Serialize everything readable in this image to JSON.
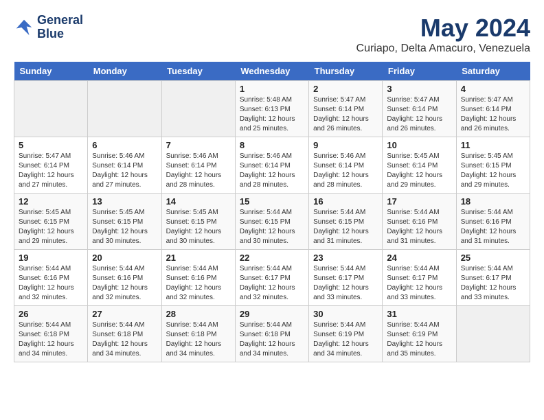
{
  "header": {
    "logo_line1": "General",
    "logo_line2": "Blue",
    "title": "May 2024",
    "subtitle": "Curiapo, Delta Amacuro, Venezuela"
  },
  "days_of_week": [
    "Sunday",
    "Monday",
    "Tuesday",
    "Wednesday",
    "Thursday",
    "Friday",
    "Saturday"
  ],
  "weeks": [
    [
      {
        "day": "",
        "info": ""
      },
      {
        "day": "",
        "info": ""
      },
      {
        "day": "",
        "info": ""
      },
      {
        "day": "1",
        "info": "Sunrise: 5:48 AM\nSunset: 6:13 PM\nDaylight: 12 hours and 25 minutes."
      },
      {
        "day": "2",
        "info": "Sunrise: 5:47 AM\nSunset: 6:14 PM\nDaylight: 12 hours and 26 minutes."
      },
      {
        "day": "3",
        "info": "Sunrise: 5:47 AM\nSunset: 6:14 PM\nDaylight: 12 hours and 26 minutes."
      },
      {
        "day": "4",
        "info": "Sunrise: 5:47 AM\nSunset: 6:14 PM\nDaylight: 12 hours and 26 minutes."
      }
    ],
    [
      {
        "day": "5",
        "info": "Sunrise: 5:47 AM\nSunset: 6:14 PM\nDaylight: 12 hours and 27 minutes."
      },
      {
        "day": "6",
        "info": "Sunrise: 5:46 AM\nSunset: 6:14 PM\nDaylight: 12 hours and 27 minutes."
      },
      {
        "day": "7",
        "info": "Sunrise: 5:46 AM\nSunset: 6:14 PM\nDaylight: 12 hours and 28 minutes."
      },
      {
        "day": "8",
        "info": "Sunrise: 5:46 AM\nSunset: 6:14 PM\nDaylight: 12 hours and 28 minutes."
      },
      {
        "day": "9",
        "info": "Sunrise: 5:46 AM\nSunset: 6:14 PM\nDaylight: 12 hours and 28 minutes."
      },
      {
        "day": "10",
        "info": "Sunrise: 5:45 AM\nSunset: 6:14 PM\nDaylight: 12 hours and 29 minutes."
      },
      {
        "day": "11",
        "info": "Sunrise: 5:45 AM\nSunset: 6:15 PM\nDaylight: 12 hours and 29 minutes."
      }
    ],
    [
      {
        "day": "12",
        "info": "Sunrise: 5:45 AM\nSunset: 6:15 PM\nDaylight: 12 hours and 29 minutes."
      },
      {
        "day": "13",
        "info": "Sunrise: 5:45 AM\nSunset: 6:15 PM\nDaylight: 12 hours and 30 minutes."
      },
      {
        "day": "14",
        "info": "Sunrise: 5:45 AM\nSunset: 6:15 PM\nDaylight: 12 hours and 30 minutes."
      },
      {
        "day": "15",
        "info": "Sunrise: 5:44 AM\nSunset: 6:15 PM\nDaylight: 12 hours and 30 minutes."
      },
      {
        "day": "16",
        "info": "Sunrise: 5:44 AM\nSunset: 6:15 PM\nDaylight: 12 hours and 31 minutes."
      },
      {
        "day": "17",
        "info": "Sunrise: 5:44 AM\nSunset: 6:16 PM\nDaylight: 12 hours and 31 minutes."
      },
      {
        "day": "18",
        "info": "Sunrise: 5:44 AM\nSunset: 6:16 PM\nDaylight: 12 hours and 31 minutes."
      }
    ],
    [
      {
        "day": "19",
        "info": "Sunrise: 5:44 AM\nSunset: 6:16 PM\nDaylight: 12 hours and 32 minutes."
      },
      {
        "day": "20",
        "info": "Sunrise: 5:44 AM\nSunset: 6:16 PM\nDaylight: 12 hours and 32 minutes."
      },
      {
        "day": "21",
        "info": "Sunrise: 5:44 AM\nSunset: 6:16 PM\nDaylight: 12 hours and 32 minutes."
      },
      {
        "day": "22",
        "info": "Sunrise: 5:44 AM\nSunset: 6:17 PM\nDaylight: 12 hours and 32 minutes."
      },
      {
        "day": "23",
        "info": "Sunrise: 5:44 AM\nSunset: 6:17 PM\nDaylight: 12 hours and 33 minutes."
      },
      {
        "day": "24",
        "info": "Sunrise: 5:44 AM\nSunset: 6:17 PM\nDaylight: 12 hours and 33 minutes."
      },
      {
        "day": "25",
        "info": "Sunrise: 5:44 AM\nSunset: 6:17 PM\nDaylight: 12 hours and 33 minutes."
      }
    ],
    [
      {
        "day": "26",
        "info": "Sunrise: 5:44 AM\nSunset: 6:18 PM\nDaylight: 12 hours and 34 minutes."
      },
      {
        "day": "27",
        "info": "Sunrise: 5:44 AM\nSunset: 6:18 PM\nDaylight: 12 hours and 34 minutes."
      },
      {
        "day": "28",
        "info": "Sunrise: 5:44 AM\nSunset: 6:18 PM\nDaylight: 12 hours and 34 minutes."
      },
      {
        "day": "29",
        "info": "Sunrise: 5:44 AM\nSunset: 6:18 PM\nDaylight: 12 hours and 34 minutes."
      },
      {
        "day": "30",
        "info": "Sunrise: 5:44 AM\nSunset: 6:19 PM\nDaylight: 12 hours and 34 minutes."
      },
      {
        "day": "31",
        "info": "Sunrise: 5:44 AM\nSunset: 6:19 PM\nDaylight: 12 hours and 35 minutes."
      },
      {
        "day": "",
        "info": ""
      }
    ]
  ]
}
